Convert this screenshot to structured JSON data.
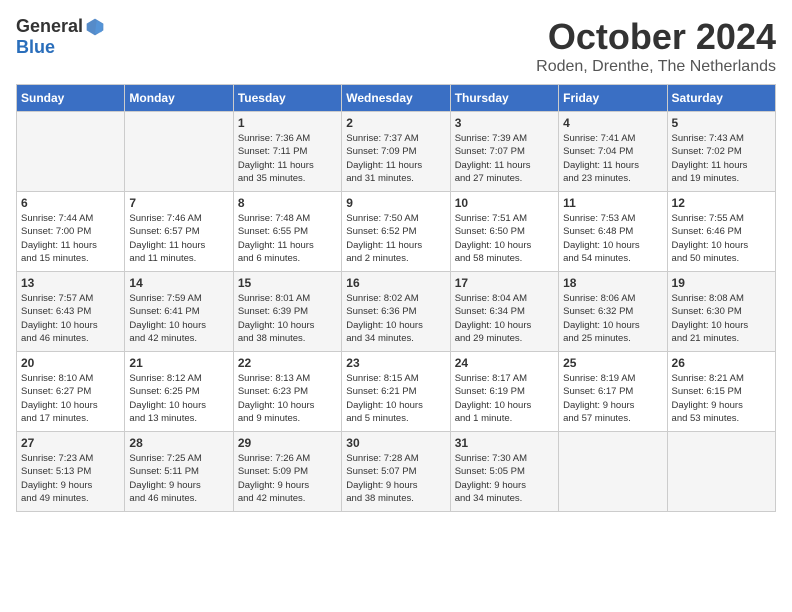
{
  "header": {
    "logo_general": "General",
    "logo_blue": "Blue",
    "month_title": "October 2024",
    "location": "Roden, Drenthe, The Netherlands"
  },
  "days_of_week": [
    "Sunday",
    "Monday",
    "Tuesday",
    "Wednesday",
    "Thursday",
    "Friday",
    "Saturday"
  ],
  "weeks": [
    [
      {
        "day": "",
        "detail": ""
      },
      {
        "day": "",
        "detail": ""
      },
      {
        "day": "1",
        "detail": "Sunrise: 7:36 AM\nSunset: 7:11 PM\nDaylight: 11 hours\nand 35 minutes."
      },
      {
        "day": "2",
        "detail": "Sunrise: 7:37 AM\nSunset: 7:09 PM\nDaylight: 11 hours\nand 31 minutes."
      },
      {
        "day": "3",
        "detail": "Sunrise: 7:39 AM\nSunset: 7:07 PM\nDaylight: 11 hours\nand 27 minutes."
      },
      {
        "day": "4",
        "detail": "Sunrise: 7:41 AM\nSunset: 7:04 PM\nDaylight: 11 hours\nand 23 minutes."
      },
      {
        "day": "5",
        "detail": "Sunrise: 7:43 AM\nSunset: 7:02 PM\nDaylight: 11 hours\nand 19 minutes."
      }
    ],
    [
      {
        "day": "6",
        "detail": "Sunrise: 7:44 AM\nSunset: 7:00 PM\nDaylight: 11 hours\nand 15 minutes."
      },
      {
        "day": "7",
        "detail": "Sunrise: 7:46 AM\nSunset: 6:57 PM\nDaylight: 11 hours\nand 11 minutes."
      },
      {
        "day": "8",
        "detail": "Sunrise: 7:48 AM\nSunset: 6:55 PM\nDaylight: 11 hours\nand 6 minutes."
      },
      {
        "day": "9",
        "detail": "Sunrise: 7:50 AM\nSunset: 6:52 PM\nDaylight: 11 hours\nand 2 minutes."
      },
      {
        "day": "10",
        "detail": "Sunrise: 7:51 AM\nSunset: 6:50 PM\nDaylight: 10 hours\nand 58 minutes."
      },
      {
        "day": "11",
        "detail": "Sunrise: 7:53 AM\nSunset: 6:48 PM\nDaylight: 10 hours\nand 54 minutes."
      },
      {
        "day": "12",
        "detail": "Sunrise: 7:55 AM\nSunset: 6:46 PM\nDaylight: 10 hours\nand 50 minutes."
      }
    ],
    [
      {
        "day": "13",
        "detail": "Sunrise: 7:57 AM\nSunset: 6:43 PM\nDaylight: 10 hours\nand 46 minutes."
      },
      {
        "day": "14",
        "detail": "Sunrise: 7:59 AM\nSunset: 6:41 PM\nDaylight: 10 hours\nand 42 minutes."
      },
      {
        "day": "15",
        "detail": "Sunrise: 8:01 AM\nSunset: 6:39 PM\nDaylight: 10 hours\nand 38 minutes."
      },
      {
        "day": "16",
        "detail": "Sunrise: 8:02 AM\nSunset: 6:36 PM\nDaylight: 10 hours\nand 34 minutes."
      },
      {
        "day": "17",
        "detail": "Sunrise: 8:04 AM\nSunset: 6:34 PM\nDaylight: 10 hours\nand 29 minutes."
      },
      {
        "day": "18",
        "detail": "Sunrise: 8:06 AM\nSunset: 6:32 PM\nDaylight: 10 hours\nand 25 minutes."
      },
      {
        "day": "19",
        "detail": "Sunrise: 8:08 AM\nSunset: 6:30 PM\nDaylight: 10 hours\nand 21 minutes."
      }
    ],
    [
      {
        "day": "20",
        "detail": "Sunrise: 8:10 AM\nSunset: 6:27 PM\nDaylight: 10 hours\nand 17 minutes."
      },
      {
        "day": "21",
        "detail": "Sunrise: 8:12 AM\nSunset: 6:25 PM\nDaylight: 10 hours\nand 13 minutes."
      },
      {
        "day": "22",
        "detail": "Sunrise: 8:13 AM\nSunset: 6:23 PM\nDaylight: 10 hours\nand 9 minutes."
      },
      {
        "day": "23",
        "detail": "Sunrise: 8:15 AM\nSunset: 6:21 PM\nDaylight: 10 hours\nand 5 minutes."
      },
      {
        "day": "24",
        "detail": "Sunrise: 8:17 AM\nSunset: 6:19 PM\nDaylight: 10 hours\nand 1 minute."
      },
      {
        "day": "25",
        "detail": "Sunrise: 8:19 AM\nSunset: 6:17 PM\nDaylight: 9 hours\nand 57 minutes."
      },
      {
        "day": "26",
        "detail": "Sunrise: 8:21 AM\nSunset: 6:15 PM\nDaylight: 9 hours\nand 53 minutes."
      }
    ],
    [
      {
        "day": "27",
        "detail": "Sunrise: 7:23 AM\nSunset: 5:13 PM\nDaylight: 9 hours\nand 49 minutes."
      },
      {
        "day": "28",
        "detail": "Sunrise: 7:25 AM\nSunset: 5:11 PM\nDaylight: 9 hours\nand 46 minutes."
      },
      {
        "day": "29",
        "detail": "Sunrise: 7:26 AM\nSunset: 5:09 PM\nDaylight: 9 hours\nand 42 minutes."
      },
      {
        "day": "30",
        "detail": "Sunrise: 7:28 AM\nSunset: 5:07 PM\nDaylight: 9 hours\nand 38 minutes."
      },
      {
        "day": "31",
        "detail": "Sunrise: 7:30 AM\nSunset: 5:05 PM\nDaylight: 9 hours\nand 34 minutes."
      },
      {
        "day": "",
        "detail": ""
      },
      {
        "day": "",
        "detail": ""
      }
    ]
  ]
}
